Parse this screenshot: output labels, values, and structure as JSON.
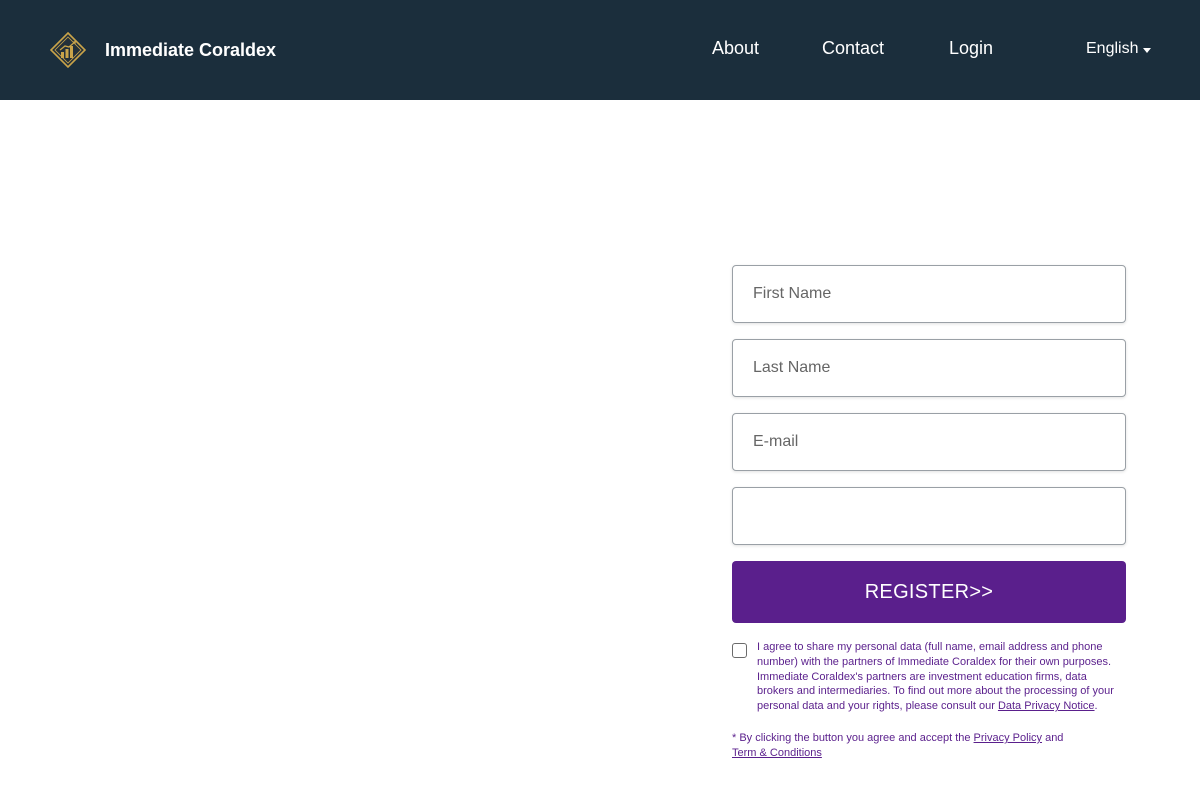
{
  "colors": {
    "header_bg": "#1b2e3c",
    "accent": "#5a1f8c",
    "text_accent": "#5a1f8c",
    "logo_gold": "#c9a44a"
  },
  "header": {
    "brand_name": "Immediate Coraldex",
    "logo_icon": "bar-chart-diamond-logo",
    "nav": {
      "about": "About",
      "contact": "Contact",
      "login": "Login"
    },
    "language": "English"
  },
  "form": {
    "first_name_placeholder": "First Name",
    "last_name_placeholder": "Last Name",
    "email_placeholder": "E-mail",
    "phone_placeholder": "",
    "register_label": "REGISTER>>",
    "consent": {
      "checked": false,
      "text": "I agree to share my personal data (full name, email address and phone number) with the partners of Immediate Coraldex for their own purposes. Immediate Coraldex's partners are investment education firms, data brokers and intermediaries. To find out more about the processing of your personal data and your rights, please consult our ",
      "link_label": "Data Privacy Notice",
      "suffix": "."
    },
    "disclaimer": {
      "prefix": "* By clicking the button you agree and accept the ",
      "privacy_label": "Privacy Policy",
      "middle": " and",
      "terms_label": "Term & Conditions"
    }
  }
}
